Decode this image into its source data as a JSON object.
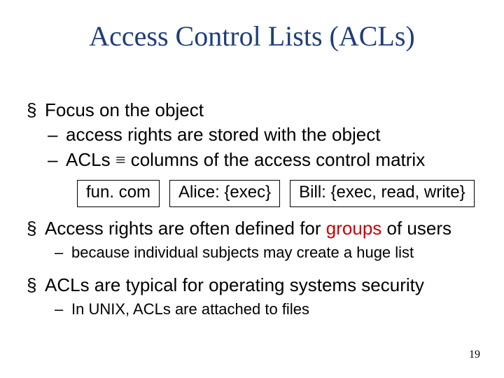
{
  "title": "Access Control Lists (ACLs)",
  "bullets": {
    "b1": "Focus on the object",
    "b1a": "access rights are stored with the object",
    "b1b_pre": "ACLs ",
    "b1b_sym": "≡",
    "b1b_post": " columns of the access control matrix",
    "b2_pre": "Access rights are often defined for ",
    "b2_red": "groups",
    "b2_post": " of users",
    "b2a": "because individual subjects may create a huge list",
    "b3": "ACLs are typical for operating systems security",
    "b3a": "In UNIX, ACLs are attached to files"
  },
  "acl": {
    "c1": "fun. com",
    "c2": "Alice: {exec}",
    "c3": "Bill: {exec, read, write}"
  },
  "pagenum": "19"
}
